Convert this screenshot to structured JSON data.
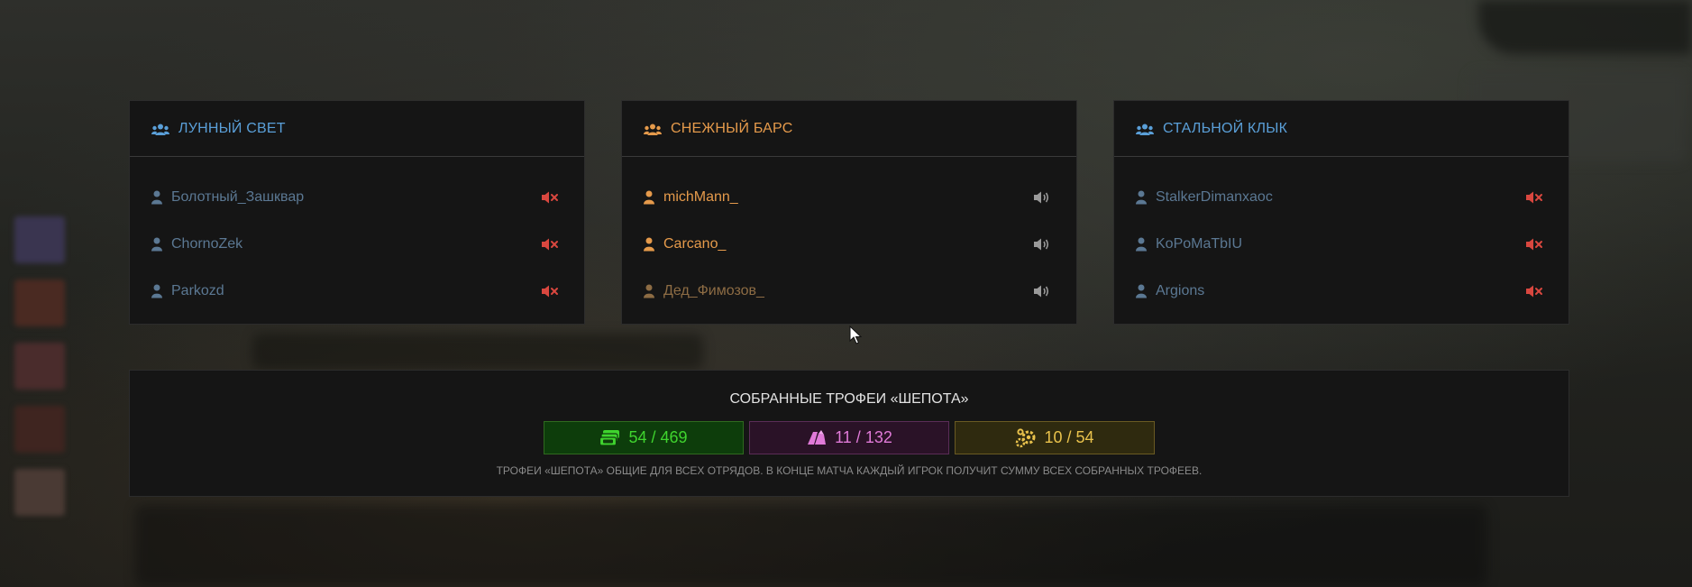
{
  "colors": {
    "team_blue": "#5a9fd8",
    "team_orange": "#e59a4b",
    "player_blue": "#5b7893",
    "player_orange": "#e59a4b",
    "player_orange_dim": "#8d6c44",
    "muted_red": "#d9473f",
    "sound_gray": "#9a9a9a",
    "trophy_green": "#3fd42e",
    "trophy_pink": "#e07ad8",
    "trophy_gold": "#e9c24c"
  },
  "squads": [
    {
      "name": "ЛУННЫЙ СВЕТ",
      "color": "blue",
      "players": [
        {
          "name": "Болотный_Зашквар",
          "audio": "muted"
        },
        {
          "name": "ChornoZek",
          "audio": "muted"
        },
        {
          "name": "Parkozd",
          "audio": "muted"
        }
      ]
    },
    {
      "name": "СНЕЖНЫЙ БАРС",
      "color": "orange",
      "players": [
        {
          "name": "michMann_",
          "audio": "on"
        },
        {
          "name": "Carcano_",
          "audio": "on"
        },
        {
          "name": "Дед_Фимозов_",
          "audio": "on"
        }
      ]
    },
    {
      "name": "СТАЛЬНОЙ КЛЫК",
      "color": "blue",
      "players": [
        {
          "name": "StalkerDimanxaoc",
          "audio": "muted"
        },
        {
          "name": "KoPoMaTbIU",
          "audio": "muted"
        },
        {
          "name": "Argions",
          "audio": "muted"
        }
      ]
    }
  ],
  "trophies": {
    "title": "СОБРАННЫЕ ТРОФЕИ «ШЕПОТА»",
    "counters": [
      {
        "icon": "banknotes-icon",
        "value": "54 / 469"
      },
      {
        "icon": "gems-icon",
        "value": "11 / 132"
      },
      {
        "icon": "gears-icon",
        "value": "10 / 54"
      }
    ],
    "note": "ТРОФЕИ «ШЕПОТА» ОБЩИЕ ДЛЯ ВСЕХ ОТРЯДОВ. В КОНЦЕ МАТЧА КАЖДЫЙ ИГРОК ПОЛУЧИТ СУММУ ВСЕХ СОБРАННЫХ ТРОФЕЕВ."
  }
}
